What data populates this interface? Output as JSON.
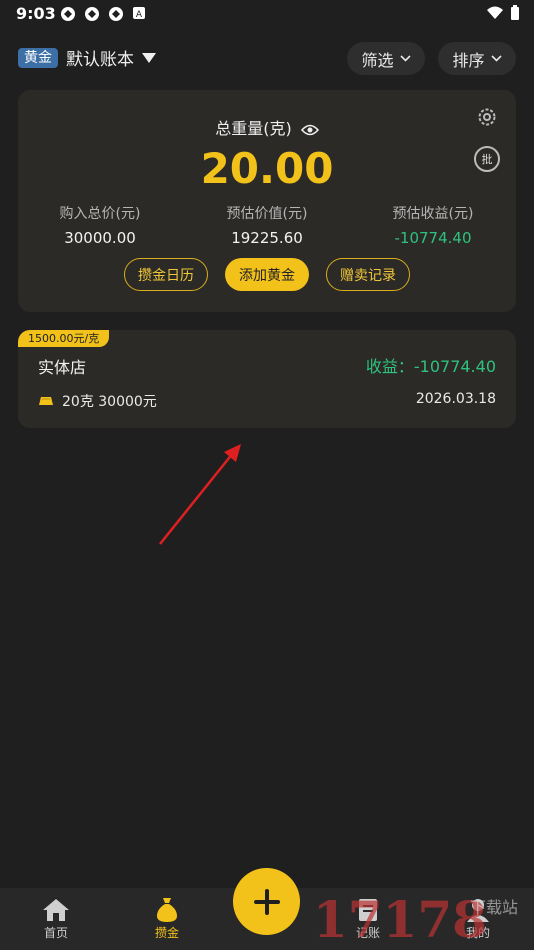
{
  "status_bar": {
    "time": "9:03"
  },
  "header": {
    "tag": "黄金",
    "book_name": "默认账本",
    "filter_label": "筛选",
    "sort_label": "排序"
  },
  "summary": {
    "total_label": "总重量(克)",
    "total_value": "20.00",
    "stats": [
      {
        "label": "购入总价(元)",
        "value": "30000.00"
      },
      {
        "label": "预估价值(元)",
        "value": "19225.60"
      },
      {
        "label": "预估收益(元)",
        "value": "-10774.40"
      }
    ],
    "batch_icon_text": "批",
    "buttons": {
      "calendar": "攒金日历",
      "add": "添加黄金",
      "records": "赠卖记录"
    }
  },
  "record": {
    "price_tag": "1500.00元/克",
    "shop": "实体店",
    "profit": "收益：-10774.40",
    "detail": "20克 30000元",
    "date": "2026.03.18"
  },
  "nav": {
    "items": [
      {
        "label": "首页",
        "icon": "home-icon"
      },
      {
        "label": "攒金",
        "icon": "money-bag-icon"
      },
      {
        "label": "记账",
        "icon": "ledger-icon"
      },
      {
        "label": "我的",
        "icon": "user-icon"
      }
    ]
  },
  "watermark": {
    "text": "17178",
    "sub": "下载站"
  },
  "colors": {
    "accent": "#f2c21a",
    "profit_negative": "#2ec27e",
    "tag_blue": "#3b6fa5"
  }
}
